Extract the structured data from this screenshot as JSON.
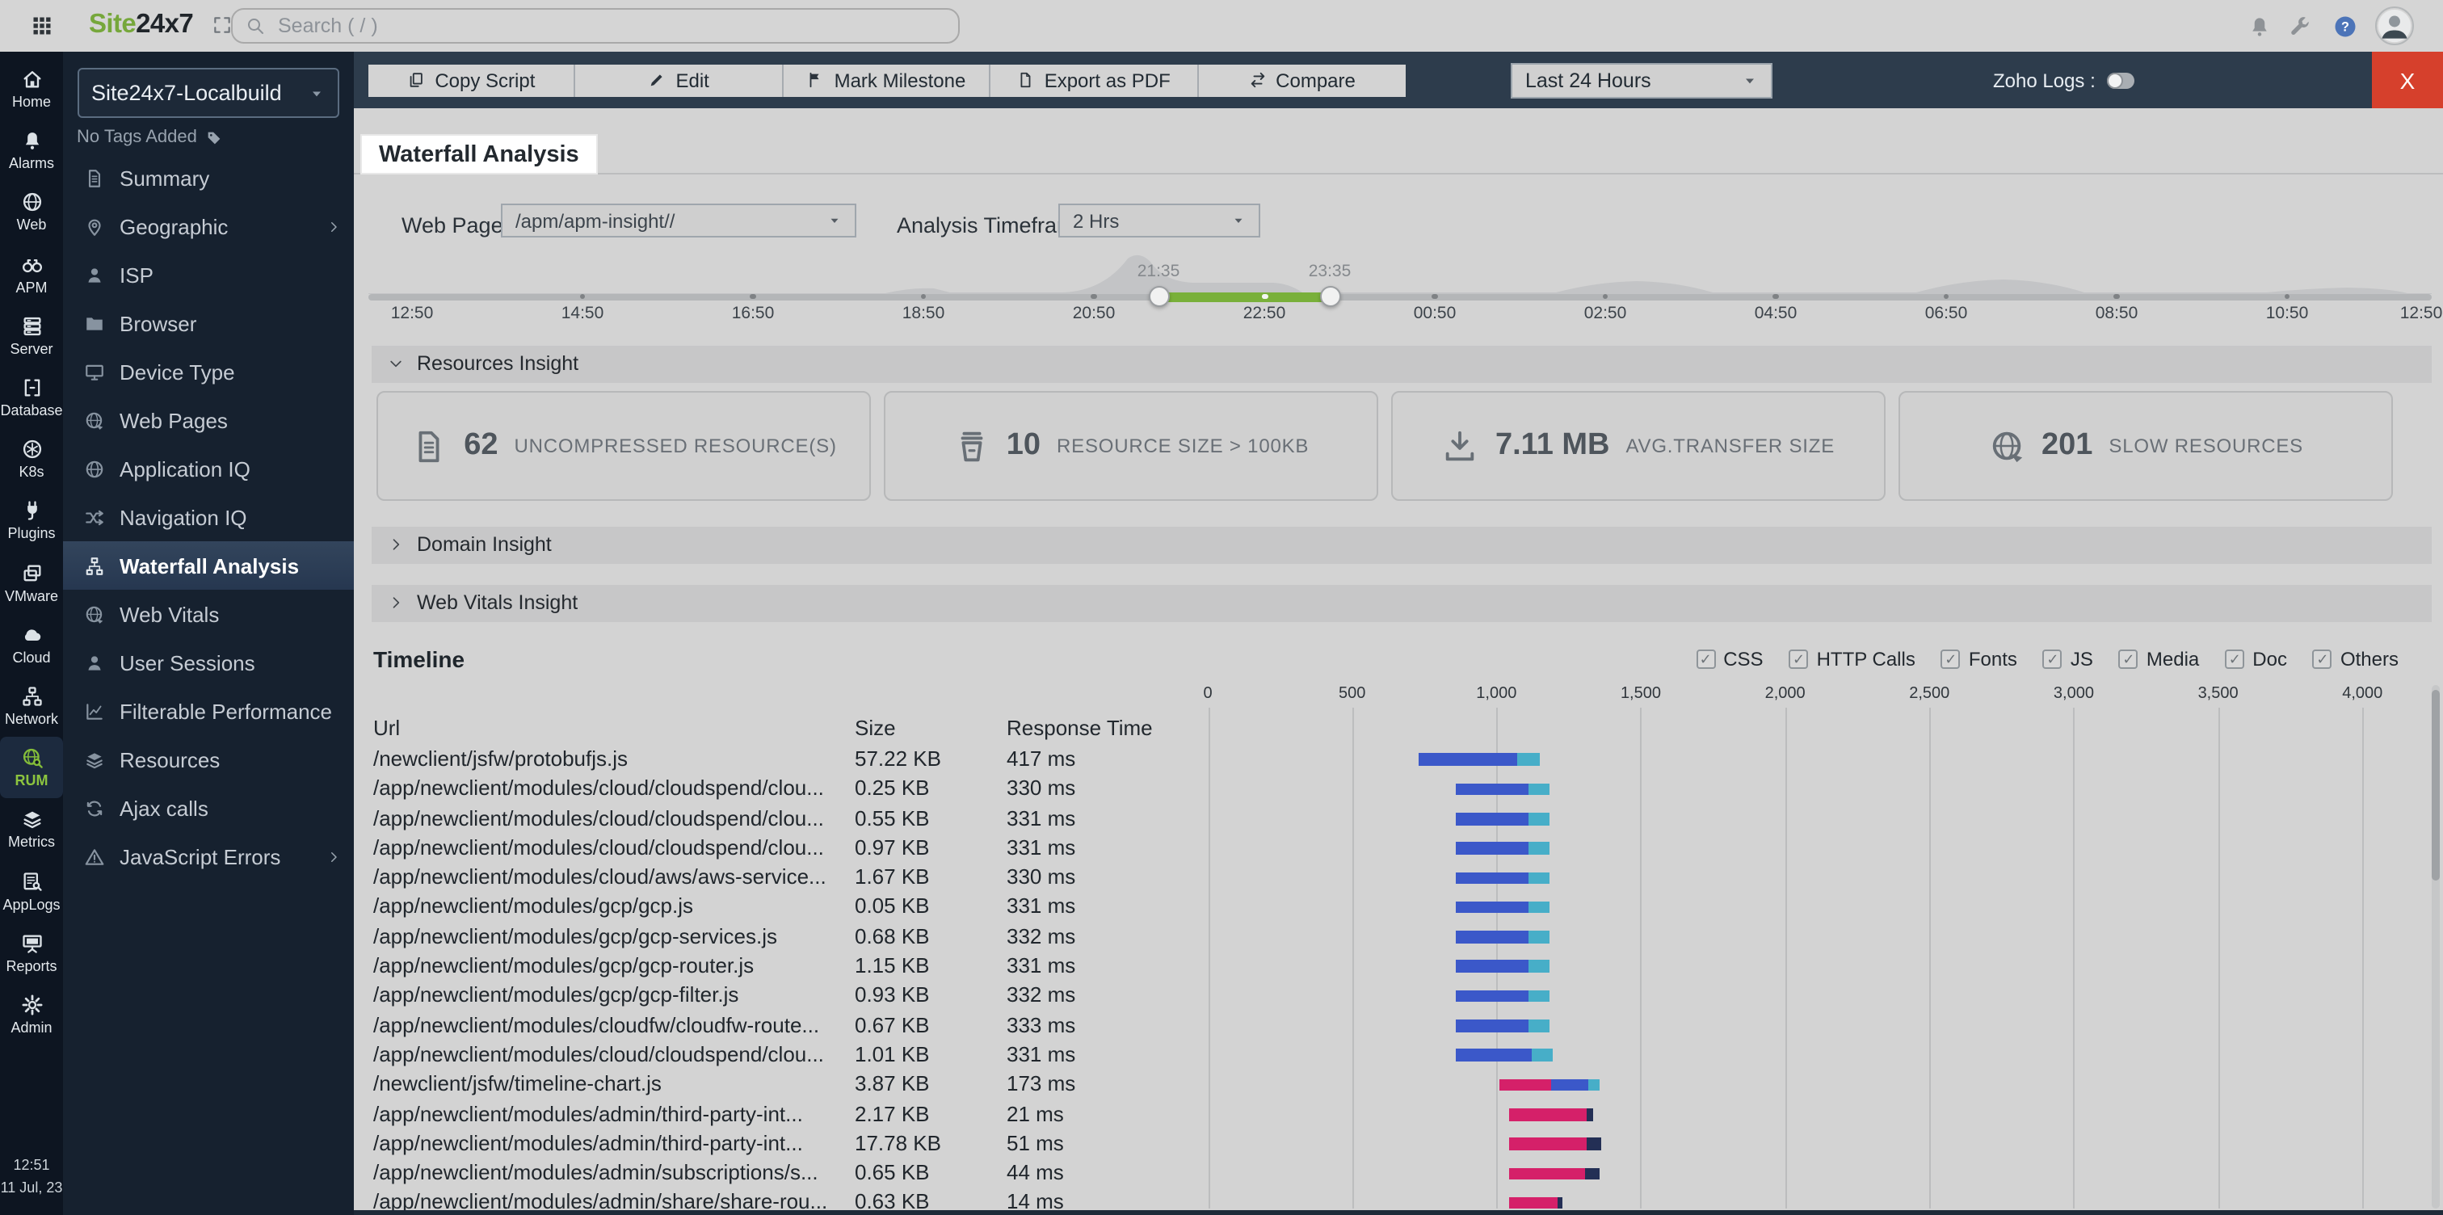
{
  "colors": {
    "logo_green": "#76a73b",
    "accent_green": "#79b03a",
    "close_red": "#d6402c",
    "rail_bg": "#0d1521",
    "toolbar_bg": "#2d3c4c"
  },
  "topbar": {
    "apps_icon": "grid",
    "logo_site": "Site",
    "logo_24x7": "24x7",
    "expand_icon": "expand",
    "search_icon": "search",
    "search_placeholder": "Search ( / )",
    "bell_icon": "bell",
    "wrench_icon": "wrench",
    "help_icon": "help",
    "avatar_icon": "avatar"
  },
  "rail": {
    "items": [
      {
        "icon": "home",
        "label": "Home"
      },
      {
        "icon": "bell",
        "label": "Alarms"
      },
      {
        "icon": "globe",
        "label": "Web"
      },
      {
        "icon": "binoculars",
        "label": "APM"
      },
      {
        "icon": "server",
        "label": "Server"
      },
      {
        "icon": "database",
        "label": "Database"
      },
      {
        "icon": "k8s",
        "label": "K8s"
      },
      {
        "icon": "plug",
        "label": "Plugins"
      },
      {
        "icon": "vmware",
        "label": "VMware"
      },
      {
        "icon": "cloud",
        "label": "Cloud"
      },
      {
        "icon": "network",
        "label": "Network"
      },
      {
        "icon": "rum",
        "label": "RUM",
        "active": true
      },
      {
        "icon": "layers",
        "label": "Metrics"
      },
      {
        "icon": "applogs",
        "label": "AppLogs"
      },
      {
        "icon": "reports",
        "label": "Reports"
      },
      {
        "icon": "gear",
        "label": "Admin"
      }
    ],
    "clock_time": "12:51",
    "clock_date": "11 Jul, 23"
  },
  "sidebar": {
    "monitor_name": "Site24x7-Localbuild",
    "monitor_caret_icon": "caret",
    "tags_label": "No Tags Added",
    "tag_icon": "tag",
    "items": [
      {
        "icon": "doc",
        "label": "Summary"
      },
      {
        "icon": "pin",
        "label": "Geographic",
        "arrow": true
      },
      {
        "icon": "person",
        "label": "ISP"
      },
      {
        "icon": "folder",
        "label": "Browser"
      },
      {
        "icon": "monitor",
        "label": "Device Type"
      },
      {
        "icon": "globearrow",
        "label": "Web Pages"
      },
      {
        "icon": "globe",
        "label": "Application IQ"
      },
      {
        "icon": "shuffle",
        "label": "Navigation IQ"
      },
      {
        "icon": "sitemap",
        "label": "Waterfall Analysis",
        "active": true
      },
      {
        "icon": "globearrow",
        "label": "Web Vitals"
      },
      {
        "icon": "person",
        "label": "User Sessions"
      },
      {
        "icon": "chart",
        "label": "Filterable Performance"
      },
      {
        "icon": "layers",
        "label": "Resources"
      },
      {
        "icon": "refresh",
        "label": "Ajax calls"
      },
      {
        "icon": "warning",
        "label": "JavaScript Errors",
        "arrow": true
      }
    ]
  },
  "toolbar": {
    "buttons": [
      {
        "icon": "copy",
        "label": "Copy Script"
      },
      {
        "icon": "edit",
        "label": "Edit"
      },
      {
        "icon": "flag",
        "label": "Mark Milestone"
      },
      {
        "icon": "pdf",
        "label": "Export as PDF"
      },
      {
        "icon": "compare",
        "label": "Compare"
      }
    ],
    "time_range": "Last 24 Hours",
    "zoho_logs_label": "Zoho Logs :",
    "close_label": "X"
  },
  "page": {
    "title": "Waterfall Analysis",
    "web_pages_label": "Web Pages",
    "web_pages_value": "/apm/apm-insight//",
    "timeframe_label": "Analysis Timeframe",
    "timeframe_value": "2 Hrs"
  },
  "slider": {
    "ticks": [
      "12:50",
      "14:50",
      "16:50",
      "18:50",
      "20:50",
      "22:50",
      "00:50",
      "02:50",
      "04:50",
      "06:50",
      "08:50",
      "10:50",
      "12:50"
    ],
    "range_start": "21:35",
    "range_end": "23:35"
  },
  "insights": {
    "resources_title": "Resources Insight",
    "cards": [
      {
        "icon": "doc",
        "value": "62",
        "label": "UNCOMPRESSED RESOURCE(S)"
      },
      {
        "icon": "basket",
        "value": "10",
        "label": "RESOURCE SIZE > 100KB"
      },
      {
        "icon": "download",
        "value": "7.11 MB",
        "label": "AVG.TRANSFER SIZE"
      },
      {
        "icon": "globearrow",
        "value": "201",
        "label": "SLOW RESOURCES"
      }
    ],
    "domain_title": "Domain Insight",
    "webvitals_title": "Web Vitals Insight"
  },
  "timeline": {
    "title": "Timeline",
    "filters": [
      "CSS",
      "HTTP Calls",
      "Fonts",
      "JS",
      "Media",
      "Doc",
      "Others"
    ],
    "columns": {
      "url": "Url",
      "size": "Size",
      "response_time": "Response Time"
    }
  },
  "chart_data": {
    "type": "waterfall-table",
    "unit": "ms",
    "axis_ticks": [
      0,
      500,
      1000,
      1500,
      2000,
      2500,
      3000,
      3500,
      4000
    ],
    "colors": {
      "blue": "#3b58c9",
      "teal": "#47aec8",
      "pink": "#d52069",
      "navy": "#232f55"
    },
    "rows": [
      {
        "url": "/newclient/jsfw/protobufjs.js",
        "size": "57.22 KB",
        "response_time": "417 ms",
        "segments": [
          {
            "c": "blue",
            "s": 730,
            "e": 1070
          },
          {
            "c": "teal",
            "s": 1070,
            "e": 1148
          }
        ]
      },
      {
        "url": "/app/newclient/modules/cloud/cloudspend/clou...",
        "size": "0.25 KB",
        "response_time": "330 ms",
        "segments": [
          {
            "c": "blue",
            "s": 860,
            "e": 1109
          },
          {
            "c": "teal",
            "s": 1109,
            "e": 1185
          }
        ]
      },
      {
        "url": "/app/newclient/modules/cloud/cloudspend/clou...",
        "size": "0.55 KB",
        "response_time": "331 ms",
        "segments": [
          {
            "c": "blue",
            "s": 860,
            "e": 1109
          },
          {
            "c": "teal",
            "s": 1109,
            "e": 1185
          }
        ]
      },
      {
        "url": "/app/newclient/modules/cloud/cloudspend/clou...",
        "size": "0.97 KB",
        "response_time": "331 ms",
        "segments": [
          {
            "c": "blue",
            "s": 860,
            "e": 1109
          },
          {
            "c": "teal",
            "s": 1109,
            "e": 1185
          }
        ]
      },
      {
        "url": "/app/newclient/modules/cloud/aws/aws-service...",
        "size": "1.67 KB",
        "response_time": "330 ms",
        "segments": [
          {
            "c": "blue",
            "s": 860,
            "e": 1109
          },
          {
            "c": "teal",
            "s": 1109,
            "e": 1185
          }
        ]
      },
      {
        "url": "/app/newclient/modules/gcp/gcp.js",
        "size": "0.05 KB",
        "response_time": "331 ms",
        "segments": [
          {
            "c": "blue",
            "s": 860,
            "e": 1109
          },
          {
            "c": "teal",
            "s": 1109,
            "e": 1185
          }
        ]
      },
      {
        "url": "/app/newclient/modules/gcp/gcp-services.js",
        "size": "0.68 KB",
        "response_time": "332 ms",
        "segments": [
          {
            "c": "blue",
            "s": 860,
            "e": 1109
          },
          {
            "c": "teal",
            "s": 1109,
            "e": 1185
          }
        ]
      },
      {
        "url": "/app/newclient/modules/gcp/gcp-router.js",
        "size": "1.15 KB",
        "response_time": "331 ms",
        "segments": [
          {
            "c": "blue",
            "s": 860,
            "e": 1109
          },
          {
            "c": "teal",
            "s": 1109,
            "e": 1185
          }
        ]
      },
      {
        "url": "/app/newclient/modules/gcp/gcp-filter.js",
        "size": "0.93 KB",
        "response_time": "332 ms",
        "segments": [
          {
            "c": "blue",
            "s": 860,
            "e": 1109
          },
          {
            "c": "teal",
            "s": 1109,
            "e": 1185
          }
        ]
      },
      {
        "url": "/app/newclient/modules/cloudfw/cloudfw-route...",
        "size": "0.67 KB",
        "response_time": "333 ms",
        "segments": [
          {
            "c": "blue",
            "s": 860,
            "e": 1109
          },
          {
            "c": "teal",
            "s": 1109,
            "e": 1185
          }
        ]
      },
      {
        "url": "/app/newclient/modules/cloud/cloudspend/clou...",
        "size": "1.01 KB",
        "response_time": "331 ms",
        "segments": [
          {
            "c": "blue",
            "s": 860,
            "e": 1125
          },
          {
            "c": "teal",
            "s": 1125,
            "e": 1195
          }
        ]
      },
      {
        "url": "/newclient/jsfw/timeline-chart.js",
        "size": "3.87 KB",
        "response_time": "173 ms",
        "segments": [
          {
            "c": "pink",
            "s": 1008,
            "e": 1188
          },
          {
            "c": "blue",
            "s": 1188,
            "e": 1320
          },
          {
            "c": "teal",
            "s": 1320,
            "e": 1356
          }
        ]
      },
      {
        "url": "/app/newclient/modules/admin/third-party-int...",
        "size": "2.17 KB",
        "response_time": "21 ms",
        "segments": [
          {
            "c": "pink",
            "s": 1042,
            "e": 1313
          },
          {
            "c": "navy",
            "s": 1313,
            "e": 1336
          }
        ]
      },
      {
        "url": "/app/newclient/modules/admin/third-party-int...",
        "size": "17.78 KB",
        "response_time": "51 ms",
        "segments": [
          {
            "c": "pink",
            "s": 1042,
            "e": 1313
          },
          {
            "c": "navy",
            "s": 1313,
            "e": 1364
          }
        ]
      },
      {
        "url": "/app/newclient/modules/admin/subscriptions/s...",
        "size": "0.65 KB",
        "response_time": "44 ms",
        "segments": [
          {
            "c": "pink",
            "s": 1042,
            "e": 1308
          },
          {
            "c": "navy",
            "s": 1308,
            "e": 1356
          }
        ]
      },
      {
        "url": "/app/newclient/modules/admin/share/share-rou...",
        "size": "0.63 KB",
        "response_time": "14 ms",
        "segments": [
          {
            "c": "pink",
            "s": 1042,
            "e": 1210
          },
          {
            "c": "navy",
            "s": 1210,
            "e": 1230
          }
        ]
      }
    ]
  }
}
